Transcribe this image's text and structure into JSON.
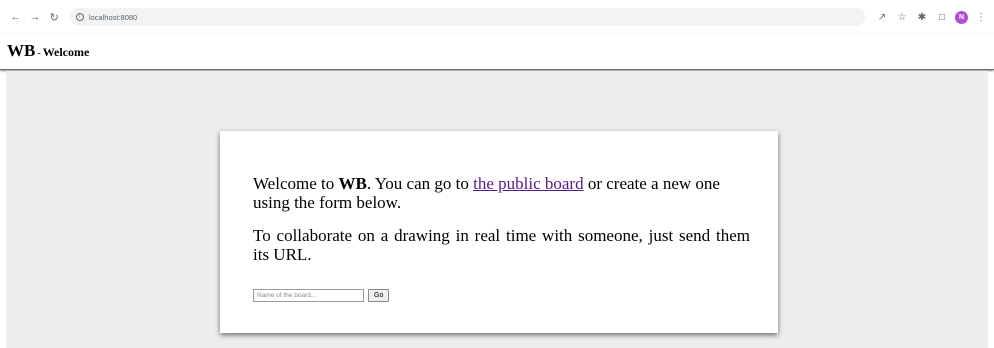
{
  "browser": {
    "url": "localhost:8080",
    "avatar_letter": "N"
  },
  "header": {
    "brand": "WB",
    "separator": "-",
    "title": "Welcome"
  },
  "card": {
    "intro_prefix": "Welcome to ",
    "intro_brand": "WB",
    "intro_mid": ". You can go to ",
    "public_board_link": "the public board",
    "intro_suffix": " or create a new one using the form below.",
    "collab_text": "To collaborate on a drawing in real time with someone, just send them its URL.",
    "board_input_placeholder": "Name of the board...",
    "go_label": "Go"
  },
  "colors": {
    "link": "#551a8b",
    "main_bg": "#eeeeee",
    "avatar_bg": "#b04fd6"
  }
}
